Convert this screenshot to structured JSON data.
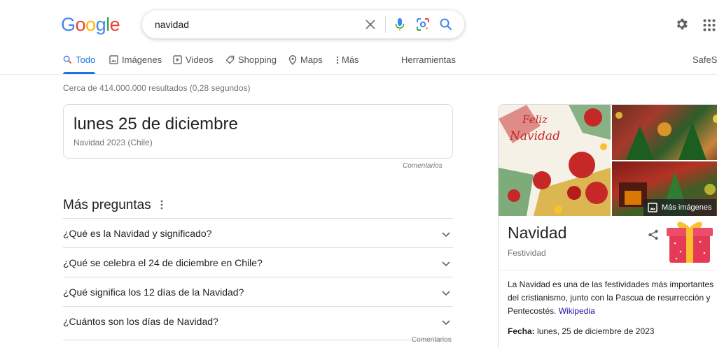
{
  "logo": {
    "letters": [
      "G",
      "o",
      "o",
      "g",
      "l",
      "e"
    ]
  },
  "search": {
    "query": "navidad"
  },
  "tabs": [
    {
      "label": "Todo",
      "icon": "search-icon",
      "active": true
    },
    {
      "label": "Imágenes",
      "icon": "image-icon"
    },
    {
      "label": "Videos",
      "icon": "play-icon"
    },
    {
      "label": "Shopping",
      "icon": "tag-icon"
    },
    {
      "label": "Maps",
      "icon": "map-pin-icon"
    },
    {
      "label": "Más",
      "icon": "more-vert-icon"
    },
    {
      "label": "Herramientas"
    },
    {
      "label": "SafeSe"
    }
  ],
  "results_stats": "Cerca de 414.000.000 resultados (0,28 segundos)",
  "date_card": {
    "title": "lunes 25 de diciembre",
    "subtitle": "Navidad 2023 (Chile)",
    "feedback": "Comentarios"
  },
  "people_also_ask": {
    "title": "Más preguntas",
    "questions": [
      "¿Qué es la Navidad y significado?",
      "¿Qué se celebra el 24 de diciembre en Chile?",
      "¿Qué significa los 12 días de la Navidad?",
      "¿Cuántos son los días de Navidad?"
    ],
    "feedback": "Comentarios"
  },
  "knowledge_panel": {
    "image_text_line1": "Feliz",
    "image_text_line2": "Navidad",
    "more_images": "Más imágenes",
    "title": "Navidad",
    "subtitle": "Festividad",
    "description": "La Navidad es una de las festividades más importantes del cristianismo, junto con la Pascua de resurrección y Pentecostés.",
    "source_link": "Wikipedia",
    "fecha_label": "Fecha:",
    "fecha_value": "lunes, 25 de diciembre de 2023"
  },
  "colors": {
    "accent": "#1a73e8",
    "link": "#1a0dab",
    "text": "#202124",
    "muted": "#70757a"
  }
}
